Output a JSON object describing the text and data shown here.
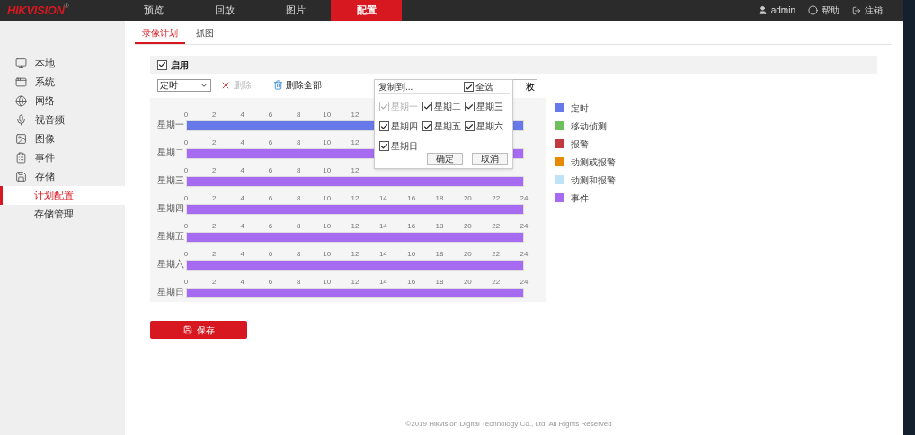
{
  "header": {
    "logo": "HIKVISION",
    "logo_mark": "®",
    "nav": [
      {
        "label": "预览",
        "selected": false
      },
      {
        "label": "回放",
        "selected": false
      },
      {
        "label": "图片",
        "selected": false
      },
      {
        "label": "配置",
        "selected": true
      }
    ],
    "user": "admin",
    "help": "帮助",
    "logout": "注销"
  },
  "sidebar": {
    "items": [
      {
        "label": "本地",
        "selected": false
      },
      {
        "label": "系统",
        "selected": false
      },
      {
        "label": "网络",
        "selected": false
      },
      {
        "label": "视音频",
        "selected": false
      },
      {
        "label": "图像",
        "selected": false
      },
      {
        "label": "事件",
        "selected": false
      },
      {
        "label": "存储",
        "selected": false,
        "children": [
          {
            "label": "计划配置",
            "selected": true
          },
          {
            "label": "存储管理",
            "selected": false
          }
        ]
      }
    ]
  },
  "tabs": [
    {
      "label": "录像计划",
      "selected": true
    },
    {
      "label": "抓图",
      "selected": false
    }
  ],
  "enable": {
    "label": "启用",
    "checked": true
  },
  "toolbar": {
    "type_select": "定时",
    "delete": {
      "label": "删除",
      "disabled": true
    },
    "delete_all": "删除全部",
    "copy_partial": "敉"
  },
  "schedule": [
    {
      "day": "星期一",
      "color": "#6779e8",
      "ticks": [
        "0",
        "2",
        "4",
        "6",
        "8",
        "10",
        "12"
      ]
    },
    {
      "day": "星期二",
      "color": "#a66bf0",
      "ticks": [
        "0",
        "2",
        "4",
        "6",
        "8",
        "10",
        "12"
      ]
    },
    {
      "day": "星期三",
      "color": "#a66bf0",
      "ticks": [
        "0",
        "2",
        "4",
        "6",
        "8",
        "10",
        "12"
      ]
    },
    {
      "day": "星期四",
      "color": "#a66bf0",
      "ticks": [
        "0",
        "2",
        "4",
        "6",
        "8",
        "10",
        "12",
        "14",
        "16",
        "18",
        "20",
        "22",
        "24"
      ]
    },
    {
      "day": "星期五",
      "color": "#a66bf0",
      "ticks": [
        "0",
        "2",
        "4",
        "6",
        "8",
        "10",
        "12",
        "14",
        "16",
        "18",
        "20",
        "22",
        "24"
      ]
    },
    {
      "day": "星期六",
      "color": "#a66bf0",
      "ticks": [
        "0",
        "2",
        "4",
        "6",
        "8",
        "10",
        "12",
        "14",
        "16",
        "18",
        "20",
        "22",
        "24"
      ]
    },
    {
      "day": "星期日",
      "color": "#a66bf0",
      "ticks": [
        "0",
        "2",
        "4",
        "6",
        "8",
        "10",
        "12",
        "14",
        "16",
        "18",
        "20",
        "22",
        "24"
      ]
    }
  ],
  "copy_popup": {
    "title": "复制到...",
    "select_all": {
      "label": "全选",
      "checked": true
    },
    "days": [
      {
        "label": "星期一",
        "checked": true,
        "disabled": true
      },
      {
        "label": "星期二",
        "checked": true,
        "disabled": false
      },
      {
        "label": "星期三",
        "checked": true,
        "disabled": false
      },
      {
        "label": "星期四",
        "checked": true,
        "disabled": false
      },
      {
        "label": "星期五",
        "checked": true,
        "disabled": false
      },
      {
        "label": "星期六",
        "checked": true,
        "disabled": false
      },
      {
        "label": "星期日",
        "checked": true,
        "disabled": false
      }
    ],
    "buttons": [
      "确定",
      "取消"
    ]
  },
  "legend": [
    {
      "label": "定时",
      "color": "#6779e8"
    },
    {
      "label": "移动侦测",
      "color": "#6cbf5c"
    },
    {
      "label": "报警",
      "color": "#c0393f"
    },
    {
      "label": "动测或报警",
      "color": "#e68a00"
    },
    {
      "label": "动测和报警",
      "color": "#bfe3f7"
    },
    {
      "label": "事件",
      "color": "#a66bf0"
    }
  ],
  "save": "保存",
  "footer": "©2019 Hikvision Digital Technology Co., Ltd. All Rights Reserved"
}
